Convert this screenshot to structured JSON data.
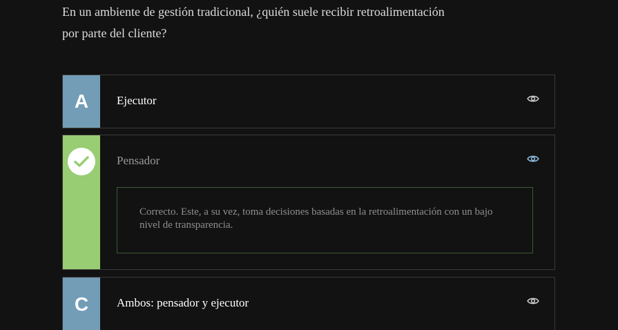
{
  "question": {
    "line1": "En un ambiente de gestión tradicional, ¿quién suele recibir retroalimentación",
    "line2": "por parte del cliente?"
  },
  "options": [
    {
      "letter": "A",
      "label": "Ejecutor",
      "state": "default",
      "icon": "eye-icon"
    },
    {
      "letter": "",
      "label": "Pensador",
      "state": "correct",
      "icon": "eye-icon",
      "badge_icon": "check-icon",
      "feedback": "Correcto. Este, a su vez, toma decisiones basadas en la retroalimentación con un bajo nivel de transparencia."
    },
    {
      "letter": "C",
      "label": "Ambos: pensador y ejecutor",
      "state": "default",
      "icon": "eye-icon"
    }
  ],
  "colors": {
    "background": "#121212",
    "badge_default": "#739db7",
    "badge_correct": "#98cd73",
    "feedback_border": "#3e5a33",
    "eye_icon": "#8fc3e6"
  }
}
